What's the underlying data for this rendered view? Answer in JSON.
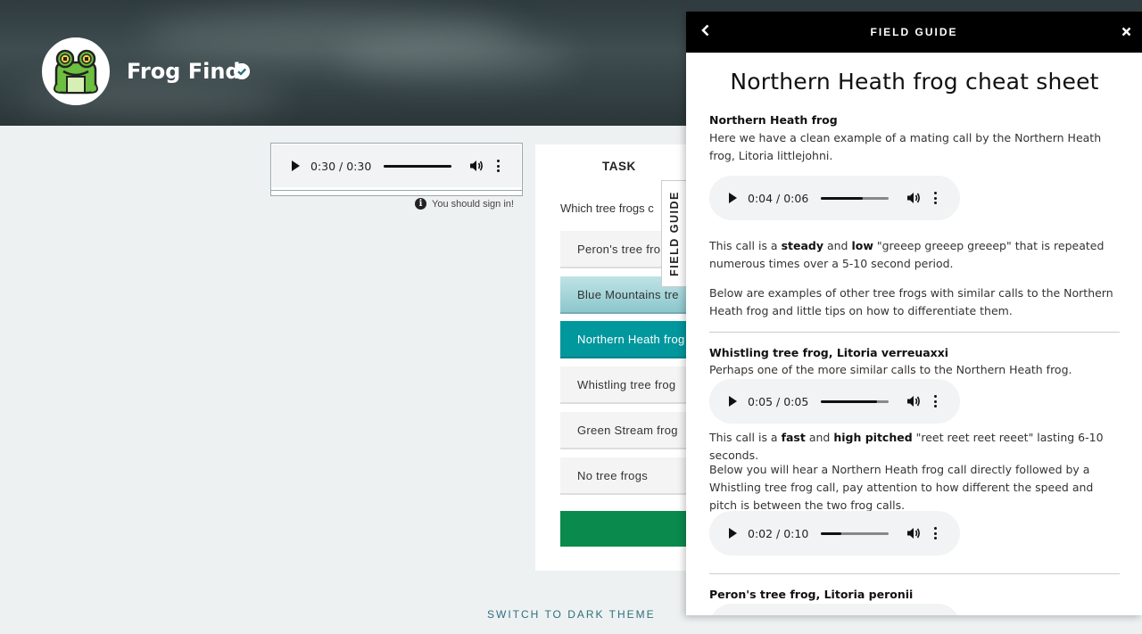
{
  "project": {
    "title": "Frog Find",
    "verified_icon": "check-circle-icon"
  },
  "subject": {
    "audio": {
      "time": "0:30 / 0:30",
      "progress": 1.0
    },
    "signin_note": "You should sign in!"
  },
  "task": {
    "heading": "TASK",
    "question": "Which tree frogs c",
    "answers": [
      {
        "label": "Peron's tree fro"
      },
      {
        "label": "Blue Mountains tre"
      },
      {
        "label": "Northern Heath frog"
      },
      {
        "label": "Whistling tree frog"
      },
      {
        "label": "Green Stream frog"
      },
      {
        "label": "No tree frogs"
      }
    ],
    "selected_index": 2,
    "hover_index": 1
  },
  "field_guide_tab": "FIELD GUIDE",
  "footer": {
    "dark_theme": "SWITCH TO DARK THEME"
  },
  "drawer": {
    "title": "FIELD GUIDE",
    "sheet_title": "Northern Heath frog cheat sheet",
    "section1": {
      "heading": "Northern Heath frog",
      "intro": "Here we have a clean example of a mating call by the Northern Heath frog, Litoria littlejohni.",
      "audio": {
        "time": "0:04 / 0:06",
        "progress": 0.62
      },
      "desc_pre": "This call is a ",
      "desc_b1": "steady",
      "desc_mid": " and ",
      "desc_b2": "low",
      "desc_post": " \"greeep greeep greeep\" that is repeated numerous times over a 5-10 second period.",
      "below": "Below are examples of other tree frogs with similar calls to the Northern Heath frog and little tips on how to differentiate them."
    },
    "section2": {
      "heading": "Whistling tree frog, Litoria verreuaxxi",
      "intro": "Perhaps one of the more similar calls to the Northern Heath frog.",
      "audio": {
        "time": "0:05 / 0:05",
        "progress": 0.82
      },
      "desc_pre": "This call is a ",
      "desc_b1": "fast",
      "desc_mid": " and ",
      "desc_b2": "high pitched",
      "desc_post": " \"reet reet reet reeet\" lasting 6-10 seconds.",
      "below": "Below you will hear a Northern Heath frog call directly followed by a Whistling tree frog call, pay attention to how different the speed and pitch is between the two frog calls.",
      "audio2": {
        "time": "0:02 / 0:10",
        "progress": 0.3
      }
    },
    "section3": {
      "heading": "Peron's tree frog, Litoria peronii"
    }
  }
}
